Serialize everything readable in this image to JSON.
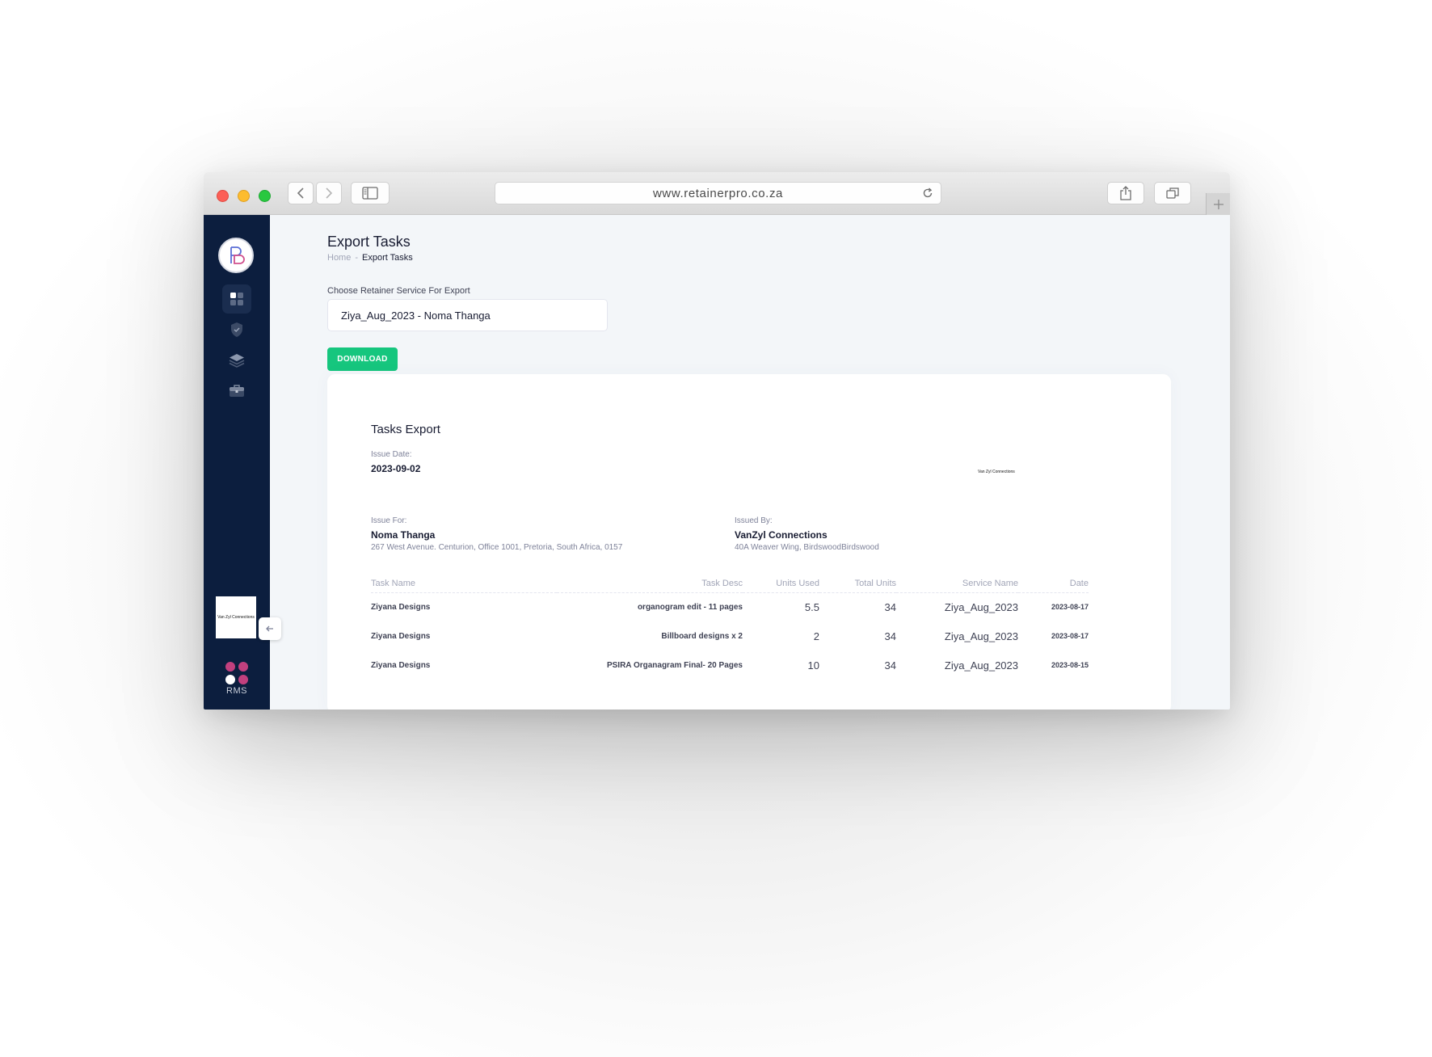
{
  "browser": {
    "url": "www.retainerpro.co.za"
  },
  "sidebar": {
    "nav": [
      {
        "name": "dashboard",
        "icon": "grid-icon"
      },
      {
        "name": "security",
        "icon": "shield-check-icon"
      },
      {
        "name": "layers",
        "icon": "layers-icon"
      },
      {
        "name": "briefcase",
        "icon": "briefcase-icon"
      }
    ],
    "client_logo_text": "Van Zyl Connections",
    "brand_label": "RMS",
    "brand_colors": [
      "#c2407e",
      "#c2407e",
      "#ffffff",
      "#c2407e"
    ]
  },
  "page": {
    "title": "Export Tasks",
    "breadcrumb": {
      "home": "Home",
      "separator": "-",
      "current": "Export Tasks"
    },
    "select_label": "Choose Retainer Service For Export",
    "select_value": "Ziya_Aug_2023 - Noma Thanga",
    "download_label": "DOWNLOAD"
  },
  "export": {
    "title": "Tasks Export",
    "issue_date_label": "Issue Date:",
    "issue_date": "2023-09-02",
    "logo_text": "Van Zyl Connections",
    "issue_for_label": "Issue For:",
    "issue_for_name": "Noma Thanga",
    "issue_for_address": "267 West Avenue. Centurion, Office 1001, Pretoria, South Africa, 0157",
    "issued_by_label": "Issued By:",
    "issued_by_name": "VanZyl Connections",
    "issued_by_address": "40A Weaver Wing, BirdswoodBirdswood",
    "columns": {
      "task_name": "Task Name",
      "task_desc": "Task Desc",
      "units_used": "Units Used",
      "total_units": "Total Units",
      "service_name": "Service Name",
      "date": "Date"
    },
    "rows": [
      {
        "task_name": "Ziyana Designs",
        "task_desc": "organogram edit - 11 pages",
        "units_used": "5.5",
        "total_units": "34",
        "service_name": "Ziya_Aug_2023",
        "date": "2023-08-17"
      },
      {
        "task_name": "Ziyana Designs",
        "task_desc": "Billboard designs x 2",
        "units_used": "2",
        "total_units": "34",
        "service_name": "Ziya_Aug_2023",
        "date": "2023-08-17"
      },
      {
        "task_name": "Ziyana Designs",
        "task_desc": "PSIRA Organagram Final- 20 Pages",
        "units_used": "10",
        "total_units": "34",
        "service_name": "Ziya_Aug_2023",
        "date": "2023-08-15"
      }
    ]
  },
  "colors": {
    "sidebar_bg": "#0c1e3e",
    "accent_green": "#16c67e",
    "page_bg": "#f3f6f9"
  }
}
